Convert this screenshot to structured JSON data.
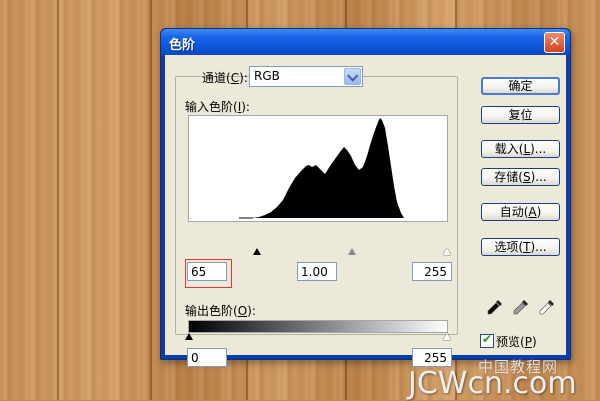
{
  "window": {
    "title": "色阶",
    "close_glyph": "✕"
  },
  "channel": {
    "label_prefix": "通道(",
    "label_key": "C",
    "label_suffix": "):",
    "value": "RGB"
  },
  "input_levels": {
    "label_prefix": "输入色阶(",
    "label_key": "I",
    "label_suffix": "):",
    "black": "65",
    "gamma": "1.00",
    "white": "255"
  },
  "output_levels": {
    "label_prefix": "输出色阶(",
    "label_key": "O",
    "label_suffix": "):",
    "black": "0",
    "white": "255"
  },
  "buttons": {
    "ok": "确定",
    "reset": "复位",
    "load": {
      "prefix": "载入(",
      "key": "L",
      "suffix": ")..."
    },
    "save": {
      "prefix": "存储(",
      "key": "S",
      "suffix": ")..."
    },
    "auto": {
      "prefix": "自动(",
      "key": "A",
      "suffix": ")"
    },
    "options": {
      "prefix": "选项(",
      "key": "T",
      "suffix": ")..."
    }
  },
  "preview": {
    "prefix": "预览(",
    "key": "P",
    "suffix": ")",
    "checked": true
  },
  "icons": [
    "black-eyedropper-icon",
    "gray-eyedropper-icon",
    "white-eyedropper-icon",
    "close-icon",
    "dropdown-arrow-icon"
  ],
  "watermark": {
    "cn": "中国教程网",
    "text": "JCWcn.com"
  }
}
